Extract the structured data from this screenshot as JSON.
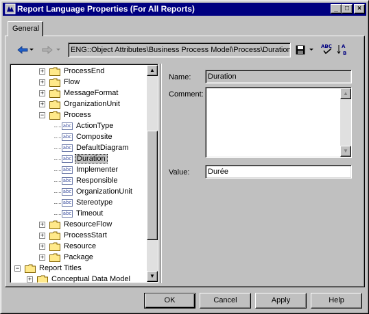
{
  "window": {
    "title": "Report Language Properties (For All Reports)",
    "minimize": "_",
    "maximize": "□",
    "close": "×"
  },
  "tabs": {
    "general": "General"
  },
  "toolbar": {
    "back_icon": "arrow-left-icon",
    "forward_icon": "arrow-right-icon",
    "path": "ENG::Object Attributes\\Business Process Model\\Process\\Duration",
    "save_icon": "floppy-disk-icon",
    "spell_icon": "spell-check-icon",
    "sort_icon": "sort-az-icon",
    "accent_color": "#000080"
  },
  "tree": {
    "rows": [
      {
        "label": "ProcessEnd",
        "kind": "folder",
        "expander": "+"
      },
      {
        "label": "Flow",
        "kind": "folder",
        "expander": "+"
      },
      {
        "label": "MessageFormat",
        "kind": "folder",
        "expander": "+"
      },
      {
        "label": "OrganizationUnit",
        "kind": "folder",
        "expander": "+"
      },
      {
        "label": "Process",
        "kind": "folder",
        "expander": "−"
      },
      {
        "label": "ActionType",
        "kind": "abc"
      },
      {
        "label": "Composite",
        "kind": "abc"
      },
      {
        "label": "DefaultDiagram",
        "kind": "abc"
      },
      {
        "label": "Duration",
        "kind": "abc",
        "selected": true
      },
      {
        "label": "Implementer",
        "kind": "abc"
      },
      {
        "label": "Responsible",
        "kind": "abc"
      },
      {
        "label": "OrganizationUnit",
        "kind": "abc"
      },
      {
        "label": "Stereotype",
        "kind": "abc"
      },
      {
        "label": "Timeout",
        "kind": "abc"
      },
      {
        "label": "ResourceFlow",
        "kind": "folder",
        "expander": "+"
      },
      {
        "label": "ProcessStart",
        "kind": "folder",
        "expander": "+"
      },
      {
        "label": "Resource",
        "kind": "folder",
        "expander": "+"
      },
      {
        "label": "Package",
        "kind": "folder",
        "expander": "+"
      },
      {
        "label": "Report Titles",
        "kind": "folder",
        "expander": "−"
      },
      {
        "label": "Conceptual Data Model",
        "kind": "folder",
        "expander": "+"
      }
    ],
    "abc_text": "abc"
  },
  "form": {
    "name_label": "Name:",
    "name_value": "Duration",
    "comment_label": "Comment:",
    "comment_value": "",
    "value_label": "Value:",
    "value_value": "Durée"
  },
  "buttons": {
    "ok": "OK",
    "cancel": "Cancel",
    "apply": "Apply",
    "help": "Help"
  }
}
